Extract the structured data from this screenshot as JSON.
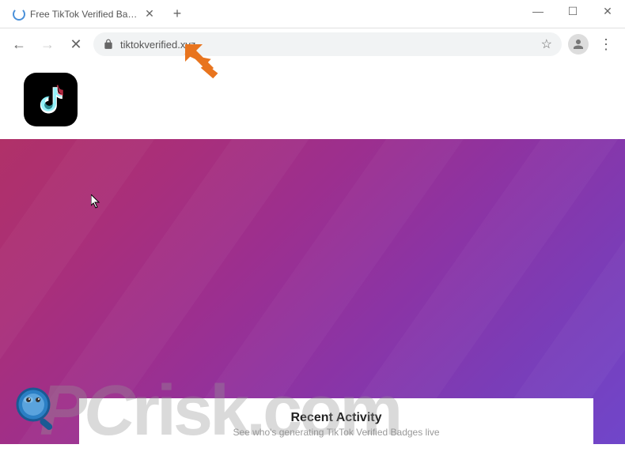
{
  "window": {
    "tab_title": "Free TikTok Verified Badge",
    "controls": {
      "minimize": "—",
      "maximize": "☐",
      "close": "✕"
    }
  },
  "address": {
    "url": "tiktokverified.xyz"
  },
  "page": {
    "activity_title": "Recent Activity",
    "activity_sub": "See who's generating TikTok Verified Badges live"
  },
  "watermark": {
    "text_prefix": "PC",
    "text_suffix": "risk.com"
  }
}
